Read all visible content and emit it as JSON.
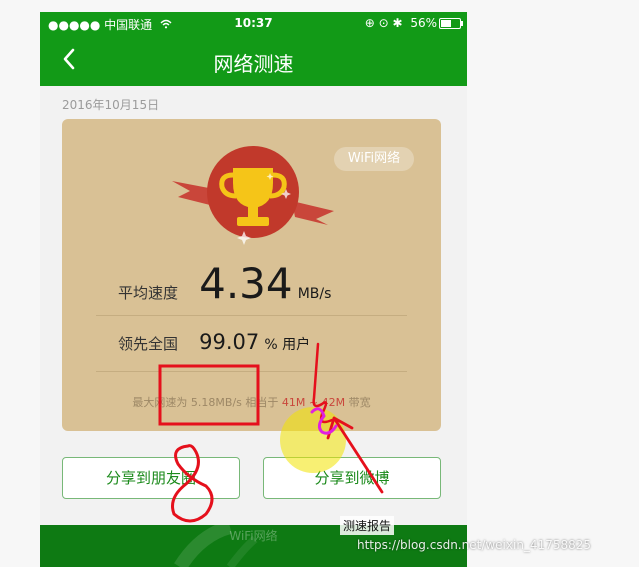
{
  "status_bar": {
    "carrier": "●●●●● 中国联通",
    "wifi_icon": "wifi-icon",
    "time": "10:37",
    "right_icons": "⊕ ⊙ ✱",
    "battery": "56%",
    "battery_level": 0.56
  },
  "nav": {
    "title": "网络测速"
  },
  "date": "2016年10月15日",
  "card": {
    "tag": "WiFi网络",
    "speed_label": "平均速度",
    "speed_value": "4.34",
    "speed_unit": "MB/s",
    "rank_label": "领先全国",
    "rank_value": "99.07",
    "rank_unit": "% 用户",
    "info_prefix": "最大网速为",
    "info_max": "5.18MB/s",
    "info_mid": "相当于",
    "info_range": "41M ~ 42M",
    "info_suffix": "带宽"
  },
  "buttons": {
    "share_friends": "分享到朋友圈",
    "share_weibo": "分享到微博"
  },
  "footer": {
    "label": "WiFi网络",
    "report": "测速报告"
  },
  "watermark": "https://blog.csdn.net/weixin_41758825",
  "colors": {
    "brand_green": "#129a17",
    "card_tan": "#d9c195",
    "trophy_red": "#c1392b",
    "trophy_gold": "#f5c518",
    "annotation_red": "#e5101c",
    "annotation_magenta": "#e020e0",
    "cursor_highlight": "#f2e300"
  }
}
